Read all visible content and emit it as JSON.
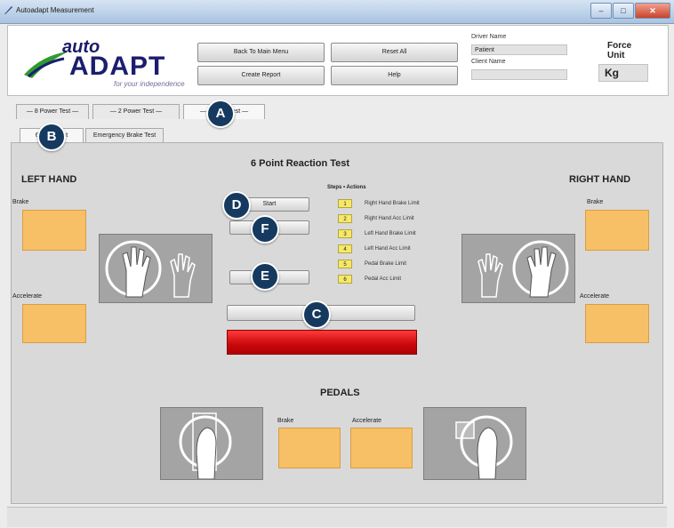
{
  "window": {
    "title": "Autoadapt Measurement"
  },
  "header": {
    "logo_auto": "auto",
    "logo_adapt": "ADAPT",
    "logo_tagline": "for your independence",
    "buttons": {
      "back": "Back To Main Menu",
      "reset": "Reset All",
      "report": "Create Report",
      "help": "Help"
    },
    "fields": {
      "driver_label": "Driver Name",
      "driver_value": "Patient",
      "client_label": "Client Name",
      "client_value": ""
    },
    "force_unit_label": "Force Unit",
    "force_unit_value": "Kg"
  },
  "tabs": [
    {
      "label": "— 8 Power Test —"
    },
    {
      "label": "— 2 Power Test —"
    },
    {
      "label": "— 6 Point Test —"
    }
  ],
  "subtabs": [
    {
      "label": "6 Point Test"
    },
    {
      "label": "Emergency Brake Test"
    }
  ],
  "main": {
    "title": "6 Point Reaction Test",
    "left_hand": "LEFT HAND",
    "right_hand": "RIGHT HAND",
    "pedals": "PEDALS",
    "labels": {
      "brake": "Brake",
      "accelerate": "Accelerate"
    },
    "start_button": "Start",
    "legend_header": "Steps • Actions",
    "legend": [
      {
        "num": "1",
        "text": "Right Hand Brake Limit"
      },
      {
        "num": "2",
        "text": "Right Hand Acc Limit"
      },
      {
        "num": "3",
        "text": "Left Hand Brake Limit"
      },
      {
        "num": "4",
        "text": "Left Hand Acc Limit"
      },
      {
        "num": "5",
        "text": "Pedal Brake Limit"
      },
      {
        "num": "6",
        "text": "Pedal Acc Limit"
      }
    ]
  },
  "callouts": {
    "a": "A",
    "b": "B",
    "c": "C",
    "d": "D",
    "e": "E",
    "f": "F"
  }
}
